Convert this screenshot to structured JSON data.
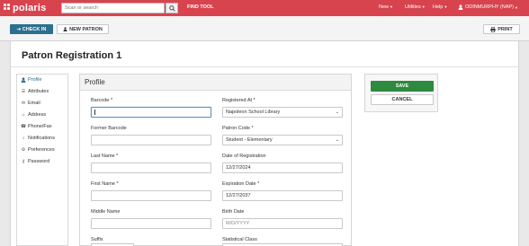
{
  "app": {
    "brand": "polaris",
    "search_placeholder": "Scan or search",
    "find_tool": "FIND TOOL",
    "menus": {
      "new": "New",
      "utilities": "Utilities",
      "help": "Help"
    },
    "user": "ODINMURPHY (NAP)",
    "accent_color": "#d7444e"
  },
  "actions": {
    "check_in": "CHECK IN",
    "new_patron": "NEW PATRON",
    "print": "PRINT"
  },
  "page": {
    "title": "Patron Registration 1"
  },
  "nav": {
    "items": [
      {
        "label": "Profile",
        "icon": "user-icon",
        "active": true
      },
      {
        "label": "Attributes",
        "icon": "list-icon",
        "active": false
      },
      {
        "label": "Email",
        "icon": "envelope-icon",
        "active": false
      },
      {
        "label": "Address",
        "icon": "home-icon",
        "active": false
      },
      {
        "label": "Phone/Fax",
        "icon": "phone-icon",
        "active": false
      },
      {
        "label": "Notifications",
        "icon": "bell-icon",
        "active": false
      },
      {
        "label": "Preferences",
        "icon": "gears-icon",
        "active": false
      },
      {
        "label": "Password",
        "icon": "key-icon",
        "active": false
      }
    ]
  },
  "profile": {
    "title": "Profile",
    "barcode": {
      "label": "Barcode *",
      "value": ""
    },
    "registered_at": {
      "label": "Registered At *",
      "value": "Napoleon School Library"
    },
    "former_barcode": {
      "label": "Former Barcode",
      "value": ""
    },
    "patron_code": {
      "label": "Patron Code *",
      "value": "Student - Elementary"
    },
    "last_name": {
      "label": "Last Name *",
      "value": ""
    },
    "date_of_registration": {
      "label": "Date of Registration",
      "value": "12/27/2024"
    },
    "first_name": {
      "label": "First Name *",
      "value": ""
    },
    "expiration_date": {
      "label": "Expiration Date *",
      "value": "12/27/2037"
    },
    "middle_name": {
      "label": "Middle Name",
      "value": ""
    },
    "birth_date": {
      "label": "Birth Date",
      "value": "",
      "placeholder": "M/D/YYYY"
    },
    "suffix": {
      "label": "Suffix"
    },
    "statistical_class": {
      "label": "Statistical Class"
    }
  },
  "save_panel": {
    "save": "SAVE",
    "cancel": "CANCEL",
    "save_color": "#2d8a3e"
  }
}
